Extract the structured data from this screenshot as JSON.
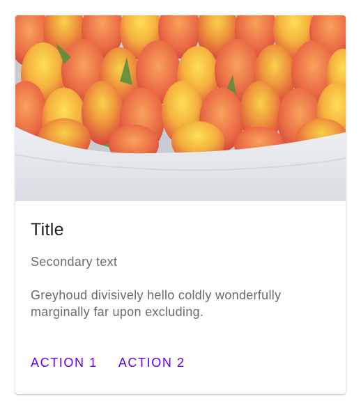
{
  "card": {
    "image_description": "tulip-bouquet-image",
    "title": "Title",
    "secondary_text": "Secondary text",
    "body_text": "Greyhoud divisively hello coldly wonderfully marginally far upon excluding."
  },
  "actions": {
    "action1_label": "ACTION 1",
    "action2_label": "ACTION 2"
  },
  "colors": {
    "accent": "#6200ee",
    "title_text": "#1c1c1c",
    "secondary_text": "#6b6b6b",
    "card_background": "#ffffff"
  }
}
